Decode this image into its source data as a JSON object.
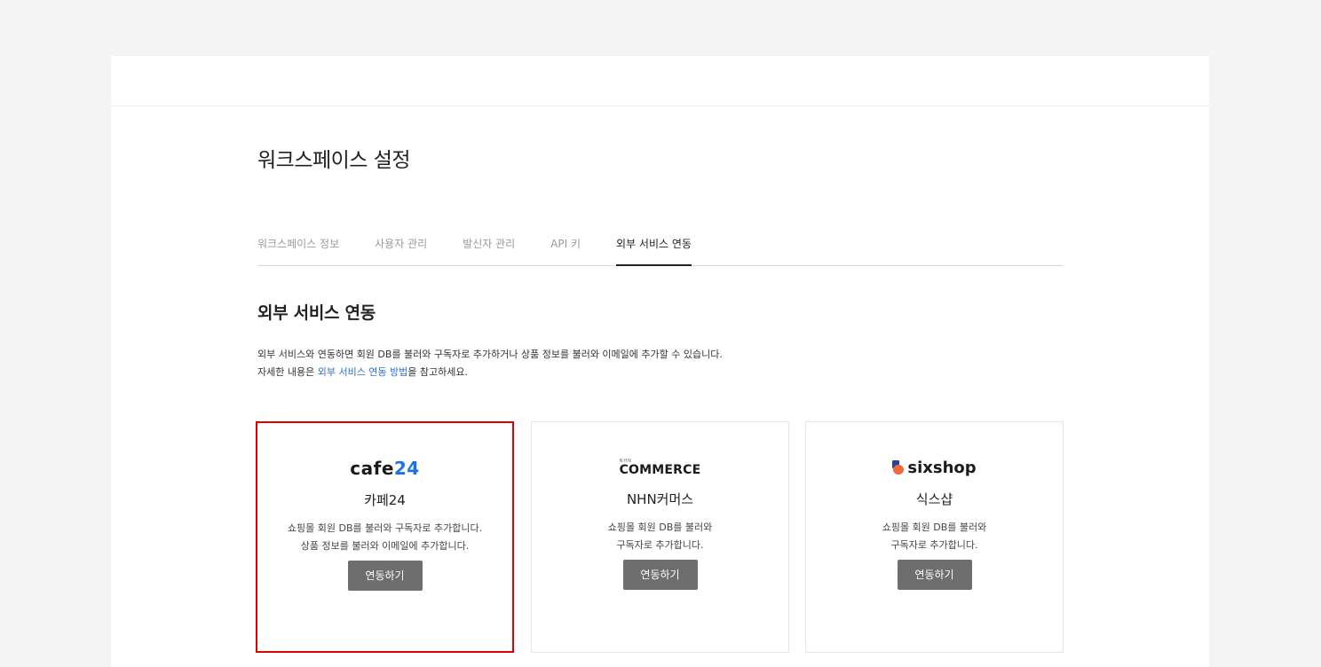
{
  "page": {
    "title": "워크스페이스 설정"
  },
  "tabs": [
    {
      "label": "워크스페이스 정보",
      "active": false
    },
    {
      "label": "사용자 관리",
      "active": false
    },
    {
      "label": "발신자 관리",
      "active": false
    },
    {
      "label": "API 키",
      "active": false
    },
    {
      "label": "외부 서비스 연동",
      "active": true
    }
  ],
  "section": {
    "title": "외부 서비스 연동",
    "desc_line1": "외부 서비스와 연동하면 회원 DB를 불러와 구독자로 추가하거나 상품 정보를 불러와 이메일에 추가할 수 있습니다.",
    "desc_line2_prefix": "자세한 내용은 ",
    "desc_line2_link": "외부 서비스 연동 방법",
    "desc_line2_suffix": "을 참고하세요."
  },
  "cards": [
    {
      "logo_text_a": "cafe",
      "logo_text_b": "24",
      "name": "카페24",
      "desc_line1": "쇼핑몰 회원 DB를 불러와 구독자로 추가합니다.",
      "desc_line2": "상품 정보를 불러와 이메일에 추가합니다.",
      "button": "연동하기",
      "selected": true
    },
    {
      "logo_text_top": "NHN",
      "logo_text_bot": "COMMERCE",
      "name": "NHN커머스",
      "desc_line1": "쇼핑몰 회원 DB를 불러와",
      "desc_line2": "구독자로 추가합니다.",
      "button": "연동하기",
      "selected": false
    },
    {
      "logo_text": "sixshop",
      "name": "식스샵",
      "desc_line1": "쇼핑몰 회원 DB를 불러와",
      "desc_line2": "구독자로 추가합니다.",
      "button": "연동하기",
      "selected": false
    }
  ],
  "colors": {
    "link": "#2f6fd6",
    "button_bg": "#6e6e6e",
    "highlight": "#e10000"
  }
}
